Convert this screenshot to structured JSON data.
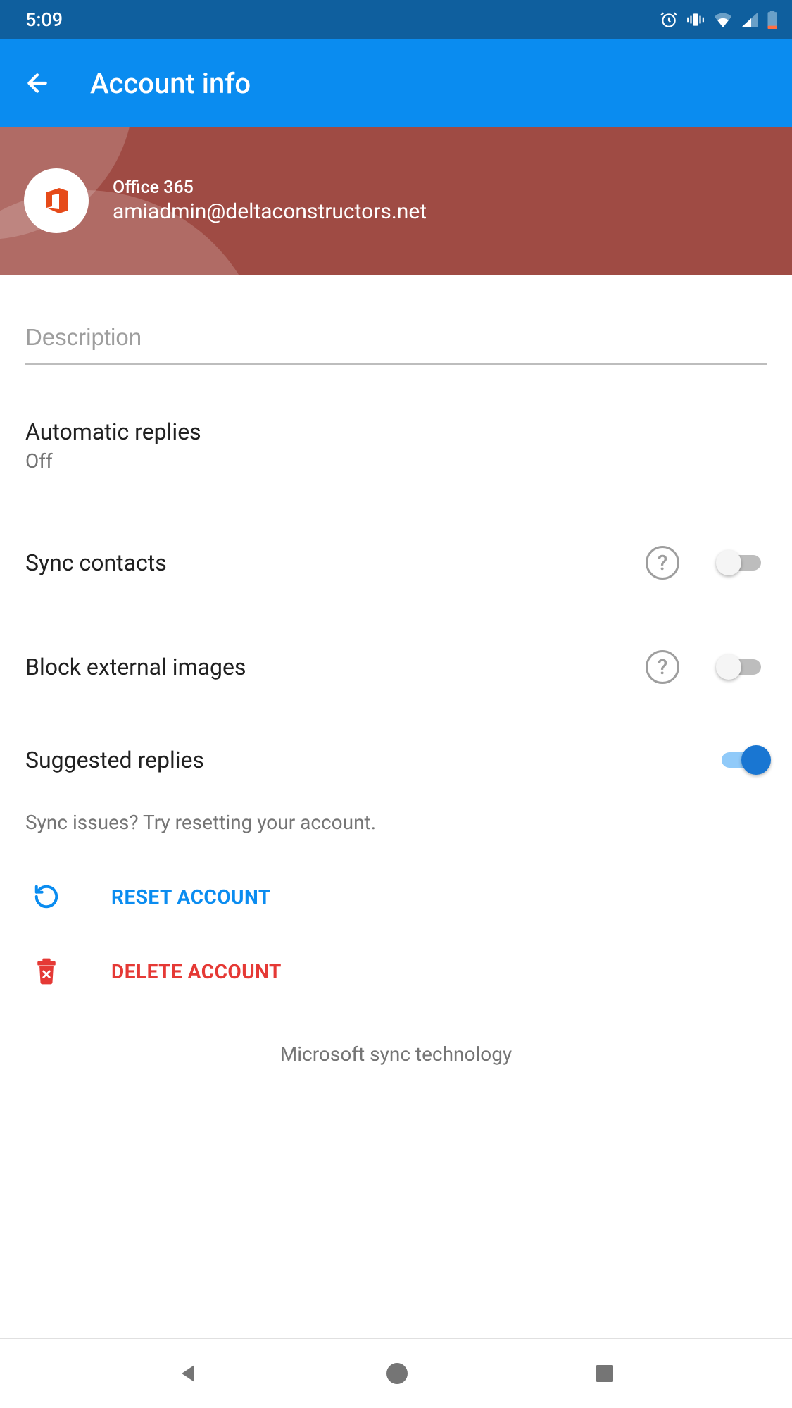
{
  "status": {
    "time": "5:09"
  },
  "appbar": {
    "title": "Account info"
  },
  "account": {
    "provider": "Office 365",
    "email": "amiadmin@deltaconstructors.net"
  },
  "description": {
    "placeholder": "Description",
    "value": ""
  },
  "settings": {
    "automatic_replies": {
      "title": "Automatic replies",
      "subtitle": "Off"
    },
    "sync_contacts": {
      "title": "Sync contacts",
      "enabled": false
    },
    "block_external_images": {
      "title": "Block external images",
      "enabled": false
    },
    "suggested_replies": {
      "title": "Suggested replies",
      "enabled": true
    }
  },
  "hint": "Sync issues? Try resetting your account.",
  "actions": {
    "reset": "RESET ACCOUNT",
    "delete": "DELETE ACCOUNT"
  },
  "footer": "Microsoft sync technology",
  "colors": {
    "status_bar": "#0f5f9e",
    "app_bar": "#0a8cf0",
    "account_header": "#9f4b44",
    "primary_blue": "#0a8cf0",
    "danger_red": "#e53935"
  }
}
